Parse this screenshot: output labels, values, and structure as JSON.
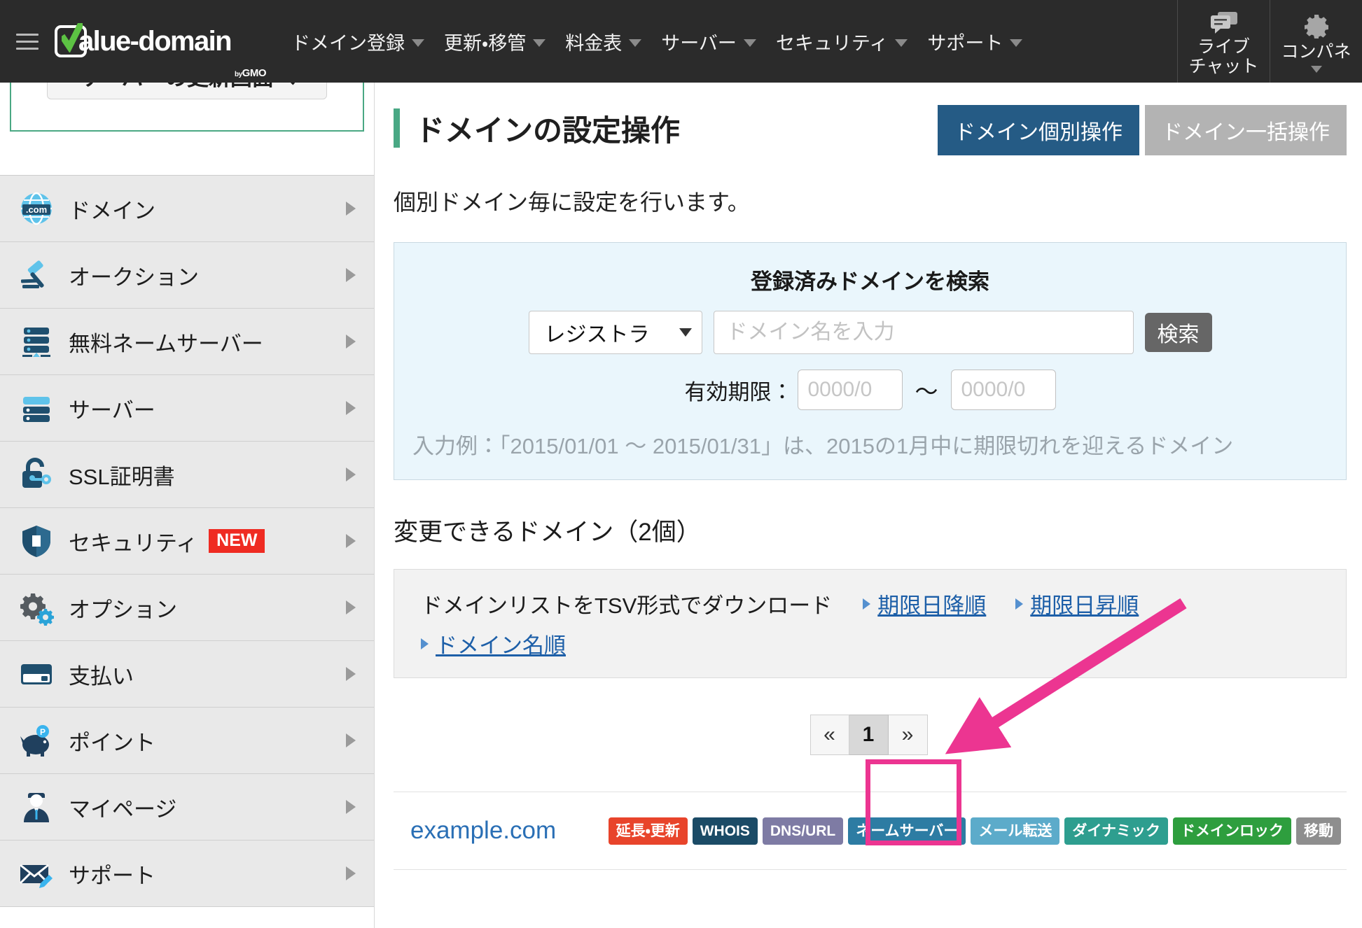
{
  "header": {
    "hamburger": "menu-icon",
    "logo_text": "alue-domain",
    "logo_by": "by",
    "logo_gmo": "GMO",
    "nav": [
      {
        "label": "ドメイン登録",
        "has_caret": true
      },
      {
        "label": "更新・移管",
        "has_caret": true
      },
      {
        "label": "料金表",
        "has_caret": true
      },
      {
        "label": "サーバー",
        "has_caret": true
      },
      {
        "label": "セキュリティ",
        "has_caret": true
      },
      {
        "label": "サポート",
        "has_caret": true
      }
    ],
    "live_chat": {
      "line1": "ライブ",
      "line2": "チャット",
      "icon": "chat-icon"
    },
    "control_panel": {
      "label": "コンパネ",
      "icon": "gear-icon"
    }
  },
  "sidebar": {
    "promo": "サーバーの更新画面へ",
    "items": [
      {
        "label": "ドメイン",
        "icon": "globe-com-icon"
      },
      {
        "label": "オークション",
        "icon": "gavel-icon"
      },
      {
        "label": "無料ネームサーバー",
        "icon": "server-stack-icon"
      },
      {
        "label": "サーバー",
        "icon": "server-icon"
      },
      {
        "label": "SSL証明書",
        "icon": "lock-key-icon"
      },
      {
        "label": "セキュリティ",
        "icon": "shield-icon",
        "badge": "NEW"
      },
      {
        "label": "オプション",
        "icon": "gears-icon"
      },
      {
        "label": "支払い",
        "icon": "credit-card-icon"
      },
      {
        "label": "ポイント",
        "icon": "piggy-bank-icon"
      },
      {
        "label": "マイページ",
        "icon": "user-icon"
      },
      {
        "label": "サポート",
        "icon": "mail-edit-icon"
      }
    ]
  },
  "main": {
    "page_title": "ドメインの設定操作",
    "btn_individual": "ドメイン個別操作",
    "btn_bulk": "ドメイン一括操作",
    "lead": "個別ドメイン毎に設定を行います。",
    "search_panel": {
      "title": "登録済みドメインを検索",
      "registrar_selected": "レジストラ",
      "domain_placeholder": "ドメイン名を入力",
      "search_button": "検索",
      "expiry_label": "有効期限：",
      "date_from_placeholder": "0000/0",
      "date_to_placeholder": "0000/0",
      "tilde": "〜",
      "note": "入力例：「2015/01/01 〜 2015/01/31」は、2015の1月中に期限切れを迎えるドメイン"
    },
    "section_heading": "変更できるドメイン（2個）",
    "tsv": {
      "label": "ドメインリストをTSV形式でダウンロード",
      "link_desc": "期限日降順",
      "link_asc": "期限日昇順",
      "link_name": "ドメイン名順"
    },
    "pager": {
      "prev": "«",
      "page1": "1",
      "next": "»"
    },
    "domain": {
      "name": "example.com",
      "tags": [
        {
          "label": "延長・更新",
          "color": "#e8442b"
        },
        {
          "label": "WHOIS",
          "color": "#1b4b66"
        },
        {
          "label": "DNS/URL",
          "color": "#7e7ba4"
        },
        {
          "label": "ネームサーバー",
          "color": "#2d7ca3"
        },
        {
          "label": "メール転送",
          "color": "#5cabca"
        },
        {
          "label": "ダイナミック",
          "color": "#2e9e8f"
        },
        {
          "label": "ドメインロック",
          "color": "#2e9e3e"
        },
        {
          "label": "移動",
          "color": "#8e8e8e"
        }
      ]
    }
  },
  "annotation": {
    "highlight_color": "#ec3591",
    "target": "DNS/URL"
  }
}
